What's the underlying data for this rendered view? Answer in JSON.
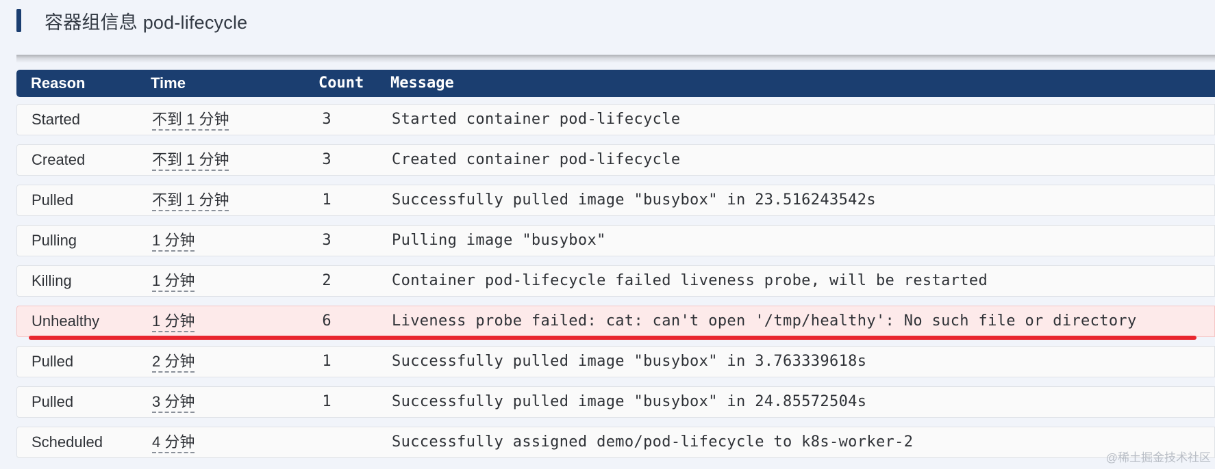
{
  "section": {
    "title": "容器组信息 pod-lifecycle"
  },
  "table": {
    "headers": {
      "reason": "Reason",
      "time": "Time",
      "count": "Count",
      "message": "Message"
    },
    "rows": [
      {
        "reason": "Started",
        "time": "不到 1 分钟",
        "count": "3",
        "message": "Started container pod-lifecycle"
      },
      {
        "reason": "Created",
        "time": "不到 1 分钟",
        "count": "3",
        "message": "Created container pod-lifecycle"
      },
      {
        "reason": "Pulled",
        "time": "不到 1 分钟",
        "count": "1",
        "message": "Successfully pulled image \"busybox\" in 23.516243542s"
      },
      {
        "reason": "Pulling",
        "time": "1 分钟",
        "count": "3",
        "message": "Pulling image \"busybox\""
      },
      {
        "reason": "Killing",
        "time": "1 分钟",
        "count": "2",
        "message": "Container pod-lifecycle failed liveness probe, will be restarted"
      },
      {
        "reason": "Unhealthy",
        "time": "1 分钟",
        "count": "6",
        "message": "Liveness probe failed: cat: can't open '/tmp/healthy': No such file or directory"
      },
      {
        "reason": "Pulled",
        "time": "2 分钟",
        "count": "1",
        "message": "Successfully pulled image \"busybox\" in 3.763339618s"
      },
      {
        "reason": "Pulled",
        "time": "3 分钟",
        "count": "1",
        "message": "Successfully pulled image \"busybox\" in 24.85572504s"
      },
      {
        "reason": "Scheduled",
        "time": "4 分钟",
        "count": "",
        "message": "Successfully assigned demo/pod-lifecycle to k8s-worker-2"
      }
    ]
  },
  "watermark": "@稀土掘金技术社区",
  "colors": {
    "header_bg": "#1b3e70",
    "warning_row_bg": "#fdeaea",
    "annotation_red": "#e8262e",
    "page_bg": "#f1f4fa"
  }
}
